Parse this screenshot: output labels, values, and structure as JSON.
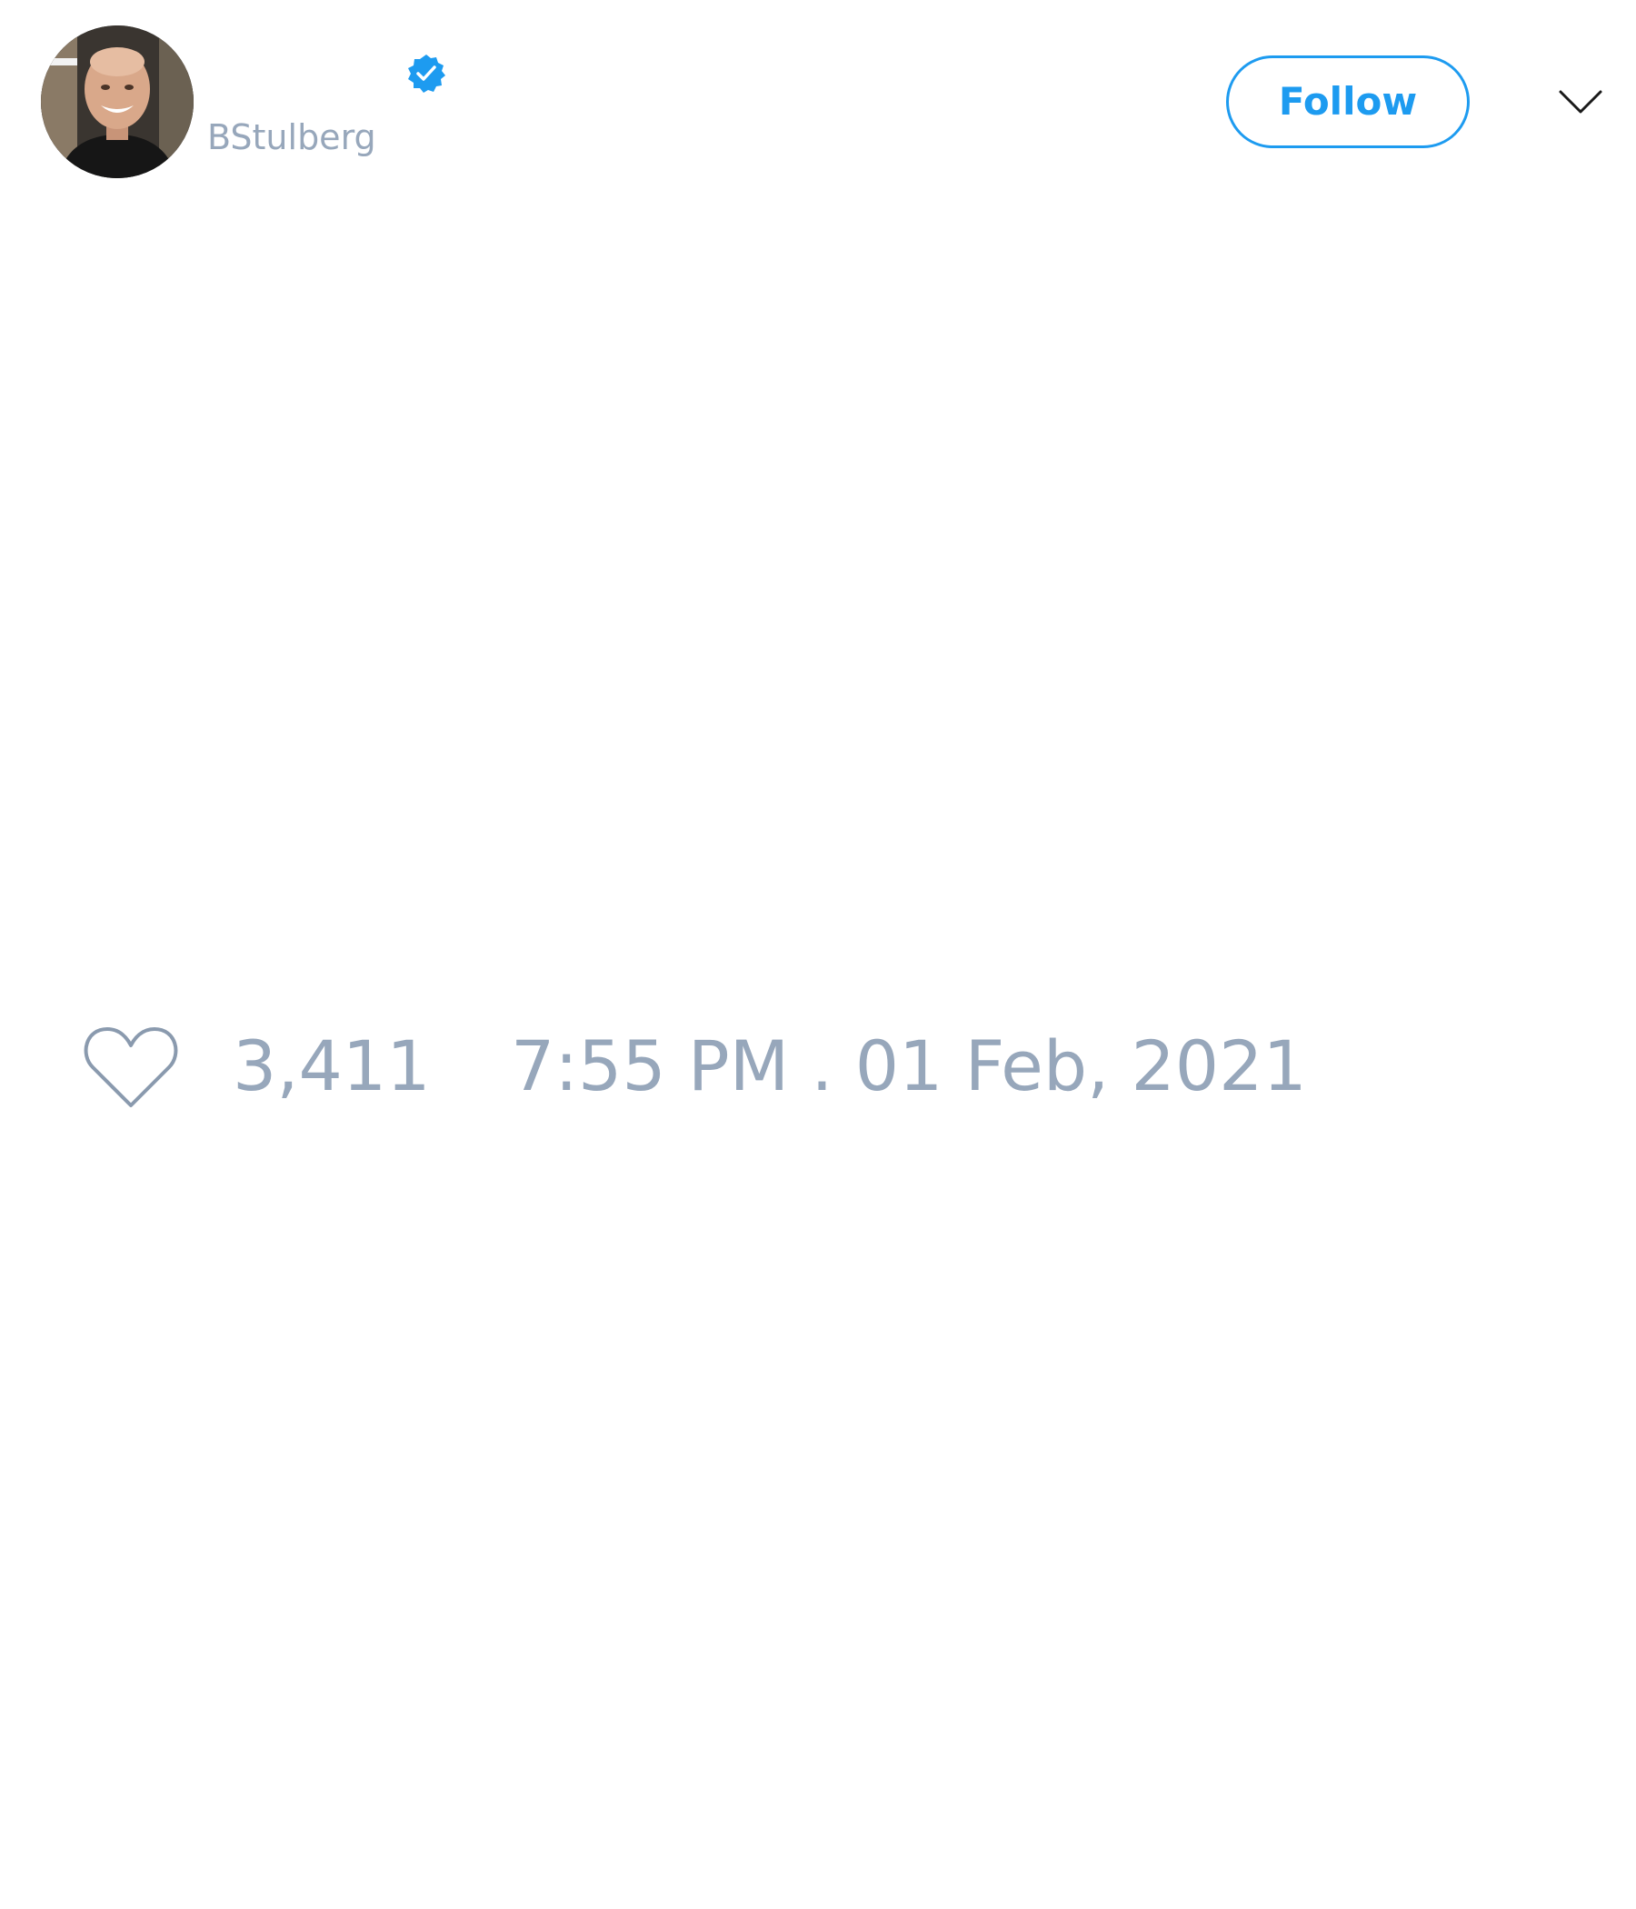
{
  "tweet": {
    "author": {
      "handle": "BStulberg",
      "verified": true,
      "avatar_icon": "profile-photo"
    },
    "follow_label": "Follow",
    "menu_icon": "chevron-down-icon",
    "like_icon": "heart-icon",
    "like_count": "3,411",
    "timestamp": "7:55 PM . 01 Feb, 2021"
  },
  "colors": {
    "accent": "#1d9bf0",
    "muted_text": "#97a7bb",
    "icon_stroke": "#8a9aae",
    "background": "#ffffff"
  }
}
